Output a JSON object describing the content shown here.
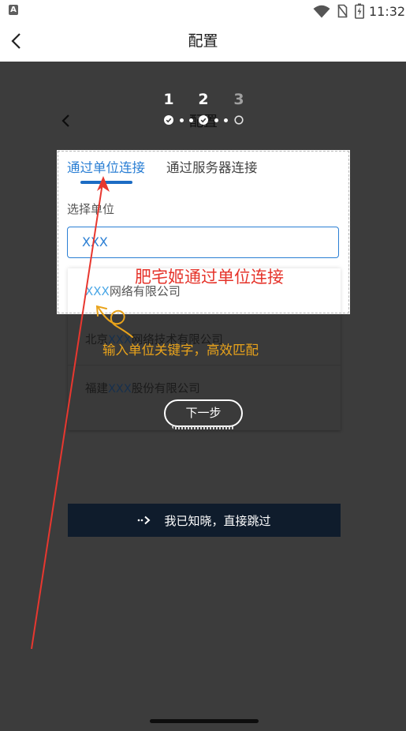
{
  "status_bar": {
    "notification_glyph": "A",
    "time": "11:32",
    "icons": [
      "app-notification-icon",
      "wifi-icon",
      "no-sim-icon",
      "battery-charging-icon"
    ]
  },
  "app_bar": {
    "title": "配置",
    "back_icon": "chevron-left-icon"
  },
  "underlay_header": {
    "title": "配置",
    "back_icon": "chevron-left-icon"
  },
  "steps": [
    {
      "label": "1",
      "completed": true
    },
    {
      "label": "2",
      "completed": true
    },
    {
      "label": "3",
      "completed": false
    }
  ],
  "connect_card": {
    "tabs": [
      {
        "label": "通过单位连接",
        "active": true
      },
      {
        "label": "通过服务器连接",
        "active": false
      }
    ],
    "field_label": "选择单位",
    "input_value": "XXX",
    "suggestions": [
      {
        "prefix": "",
        "keyword": "XXX",
        "suffix": "网络有限公司"
      },
      {
        "prefix": "北京",
        "keyword": "XXX",
        "suffix": "网络技术有限公司"
      },
      {
        "prefix": "福建",
        "keyword": "XXX",
        "suffix": "股份有限公司"
      }
    ]
  },
  "annotations": {
    "red_text": "肥宅姬通过单位连接",
    "yellow_text": "输入单位关键字，高效匹配"
  },
  "buttons": {
    "next_label": "下一步",
    "skip_label": "我已知晓，直接跳过",
    "skip_icon": "dotted-arrow-right-icon"
  },
  "colors": {
    "accent": "#2b7fd4",
    "keyword": "#4aa7e6",
    "overlay": "#3c3c3c",
    "annotation_red": "#e5332a",
    "annotation_yellow": "#e9a31b",
    "skip_background": "#0f1c2c"
  }
}
